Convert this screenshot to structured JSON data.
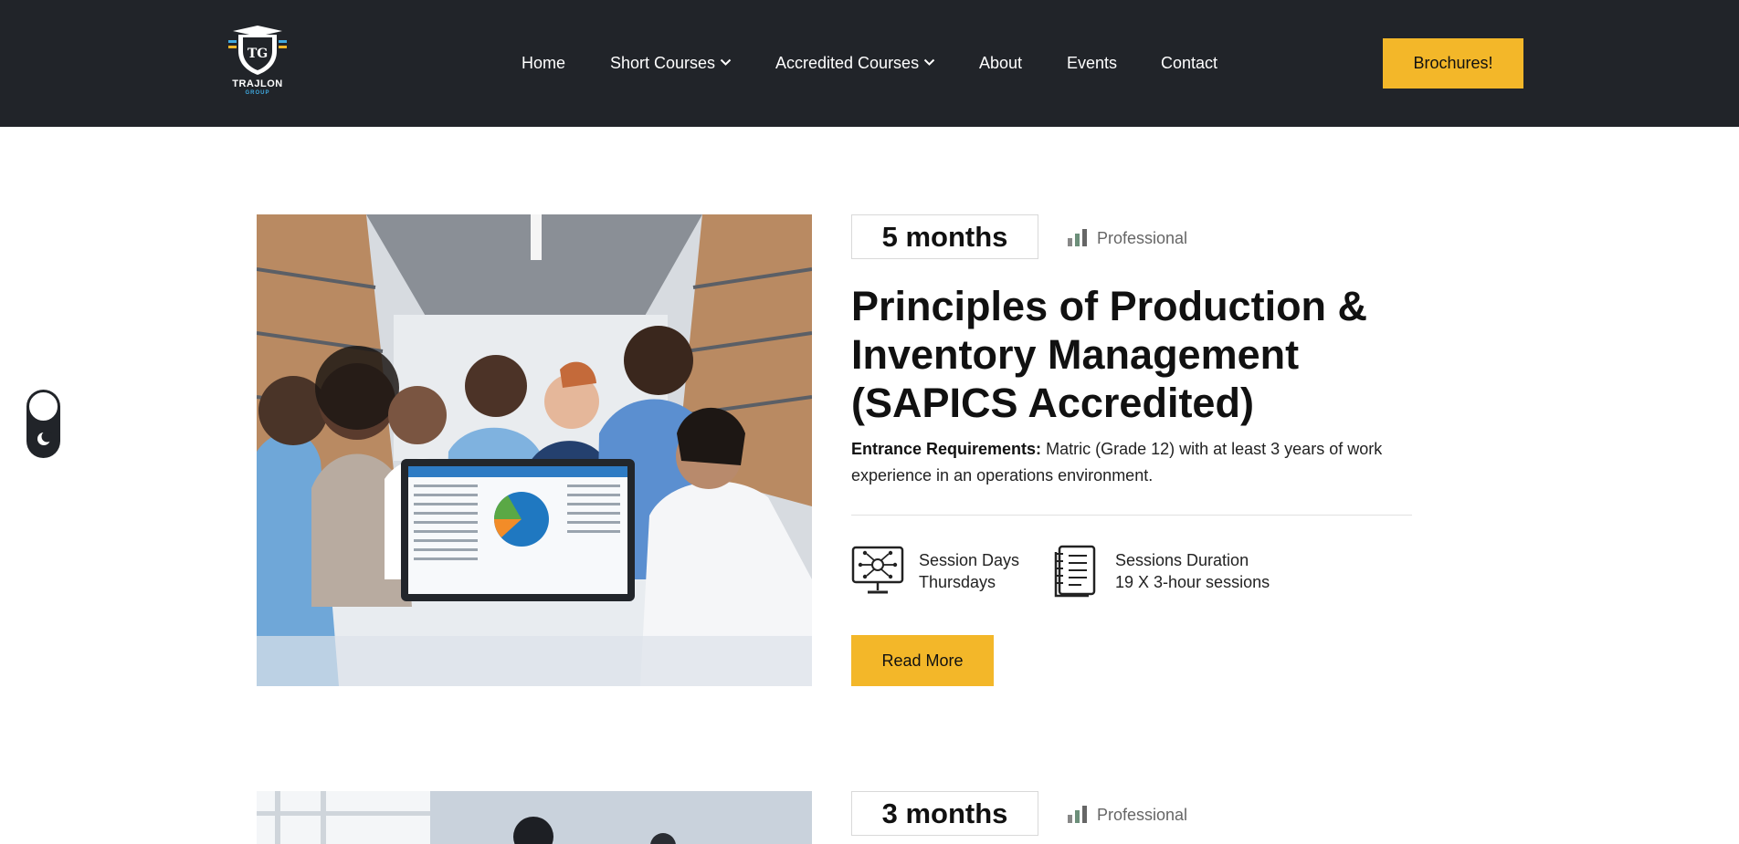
{
  "header": {
    "logo": {
      "initials": "TG",
      "name": "TRAJLON",
      "sub": "GROUP"
    },
    "nav": [
      {
        "label": "Home",
        "dropdown": false
      },
      {
        "label": "Short Courses",
        "dropdown": true
      },
      {
        "label": "Accredited Courses",
        "dropdown": true
      },
      {
        "label": "About",
        "dropdown": false
      },
      {
        "label": "Events",
        "dropdown": false
      },
      {
        "label": "Contact",
        "dropdown": false
      }
    ],
    "cta_label": "Brochures!"
  },
  "courses": [
    {
      "duration": "5 months",
      "level": "Professional",
      "title": "Principles of Production & Inventory Management (SAPICS Accredited)",
      "requirements_label": "Entrance Requirements:",
      "requirements_text": "Matric (Grade 12) with at least 3 years of work experience in an operations environment.",
      "session_days_label": "Session Days",
      "session_days_value": "Thursdays",
      "session_duration_label": "Sessions Duration",
      "session_duration_value": "19 X 3-hour sessions",
      "read_more_label": "Read More"
    },
    {
      "duration": "3 months",
      "level": "Professional"
    }
  ],
  "colors": {
    "header_bg": "#212429",
    "accent": "#f3b729",
    "logo_blue": "#3fa9e0"
  },
  "icons": {
    "level": "bar-chart-icon",
    "session_days": "monitor-network-icon",
    "session_duration": "notebook-icon",
    "theme": "moon-icon"
  }
}
